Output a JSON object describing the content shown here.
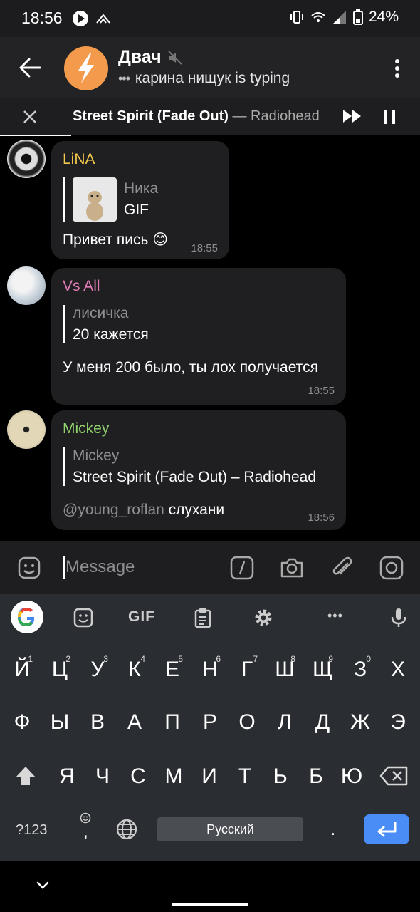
{
  "status_bar": {
    "time": "18:56",
    "battery": "24%"
  },
  "header": {
    "title": "Двач",
    "typing_dots": "•••",
    "typing_text": "карина нищук is typing",
    "accent_color": "#f39a4c"
  },
  "player": {
    "song": "Street Spirit (Fade Out)",
    "artist": "— Radiohead"
  },
  "messages": [
    {
      "sender": "LiNA",
      "sender_color": "#f2c94c",
      "reply_name": "Ника",
      "reply_text": "GIF",
      "text": "Привет пись 😊",
      "time": "18:55"
    },
    {
      "sender": "Vs All",
      "sender_color": "#e07bb5",
      "reply_name": "лисичка",
      "reply_text": "20 кажется",
      "text": "У меня 200 было, ты лох получается",
      "time": "18:55"
    },
    {
      "sender": "Mickey",
      "sender_color": "#8fd16b",
      "reply_name": "Mickey",
      "reply_text": "Street Spirit (Fade Out) – Radiohead",
      "mention": "@young_roflan",
      "text": "слухани",
      "time": "18:56"
    }
  ],
  "input": {
    "placeholder": "Message"
  },
  "keyboard": {
    "row1": [
      {
        "k": "Й",
        "n": "1"
      },
      {
        "k": "Ц",
        "n": "2"
      },
      {
        "k": "У",
        "n": "3"
      },
      {
        "k": "К",
        "n": "4"
      },
      {
        "k": "Е",
        "n": "5"
      },
      {
        "k": "Н",
        "n": "6"
      },
      {
        "k": "Г",
        "n": "7"
      },
      {
        "k": "Ш",
        "n": "8"
      },
      {
        "k": "Щ",
        "n": "9"
      },
      {
        "k": "З",
        "n": "0"
      },
      {
        "k": "Х",
        "n": ""
      }
    ],
    "row2": [
      "Ф",
      "Ы",
      "В",
      "А",
      "П",
      "Р",
      "О",
      "Л",
      "Д",
      "Ж",
      "Э"
    ],
    "row3": [
      "Я",
      "Ч",
      "С",
      "М",
      "И",
      "Т",
      "Ь",
      "Б",
      "Ю"
    ],
    "gif_label": "GIF",
    "symbols_label": "?123",
    "comma": ",",
    "space_label": "Русский",
    "period": ".",
    "dots": "•••"
  }
}
